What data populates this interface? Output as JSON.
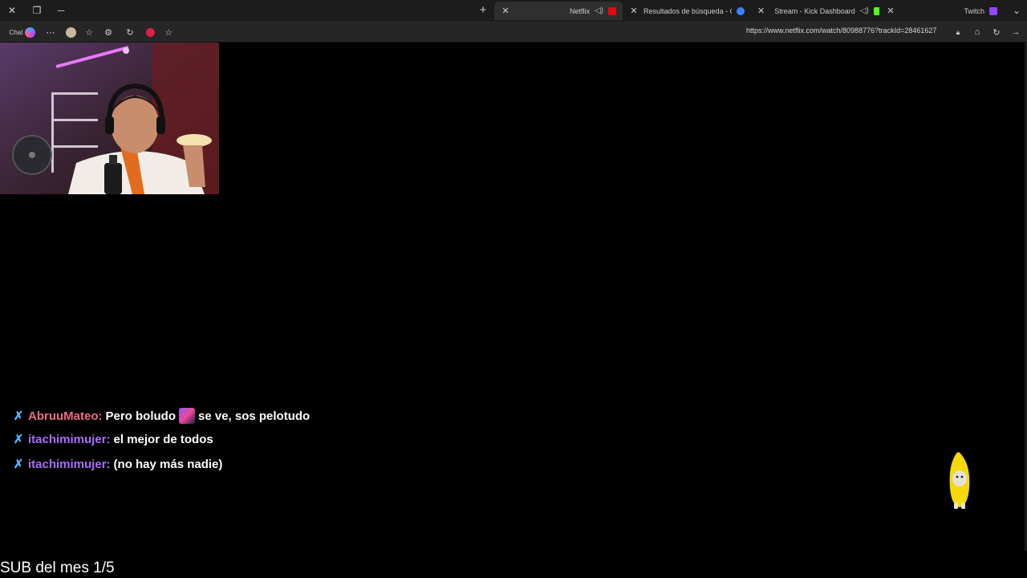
{
  "browser": {
    "tabs": [
      {
        "title": "Twitch",
        "favicon_color": "#9146ff",
        "active": false
      },
      {
        "title": "Stream - Kick Dashboard",
        "favicon_color": "#53fc18",
        "active": false
      },
      {
        "title": "Resultados de búsqueda - Cuevan",
        "favicon_color": "#3b82f6",
        "active": false
      },
      {
        "title": "Netflix",
        "favicon_color": "#e50914",
        "active": true
      }
    ],
    "new_tab_label": "+",
    "url": "https://www.netflix.com/watch/80988776?trackId=28461627",
    "chat_label": "Chat"
  },
  "chat": {
    "messages": [
      {
        "user": "AbruuMateo:",
        "text_before": "Pero boludo",
        "text_after": "se ve, sos pelotudo",
        "has_emote": true
      },
      {
        "user": "itachimimujer:",
        "text": "el mejor de todos"
      },
      {
        "user": "itachimimujer:",
        "text": "(no hay más nadie)"
      }
    ]
  },
  "overlay": {
    "sub_counter": "SUB del mes 1/5"
  },
  "colors": {
    "accent_user1": "#ef6a8c",
    "accent_user2": "#a96dff",
    "badge": "#4fb6ff"
  }
}
